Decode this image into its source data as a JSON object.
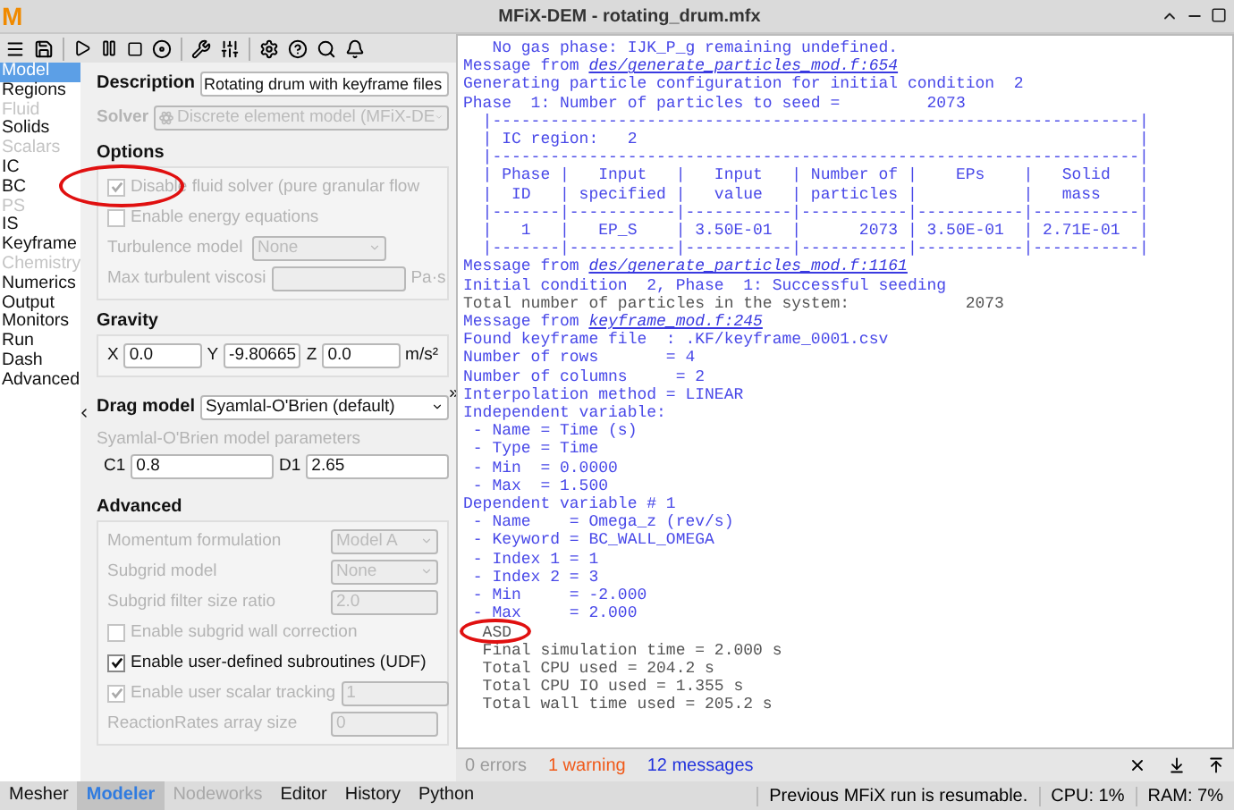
{
  "app": {
    "logo": "M",
    "title": "MFiX-DEM - rotating_drum.mfx"
  },
  "nav": [
    {
      "label": "Model",
      "selected": true,
      "disabled": false
    },
    {
      "label": "Regions",
      "selected": false,
      "disabled": false
    },
    {
      "label": "Fluid",
      "selected": false,
      "disabled": true
    },
    {
      "label": "Solids",
      "selected": false,
      "disabled": false
    },
    {
      "label": "Scalars",
      "selected": false,
      "disabled": true
    },
    {
      "label": "IC",
      "selected": false,
      "disabled": false
    },
    {
      "label": "BC",
      "selected": false,
      "disabled": false
    },
    {
      "label": "PS",
      "selected": false,
      "disabled": true
    },
    {
      "label": "IS",
      "selected": false,
      "disabled": false
    },
    {
      "label": "Keyframe",
      "selected": false,
      "disabled": false
    },
    {
      "label": "Chemistry",
      "selected": false,
      "disabled": true
    },
    {
      "label": "Numerics",
      "selected": false,
      "disabled": false
    },
    {
      "label": "Output",
      "selected": false,
      "disabled": false
    },
    {
      "label": "Monitors",
      "selected": false,
      "disabled": false
    },
    {
      "label": "Run",
      "selected": false,
      "disabled": false
    },
    {
      "label": "Dash",
      "selected": false,
      "disabled": false
    },
    {
      "label": "Advanced",
      "selected": false,
      "disabled": false
    }
  ],
  "form": {
    "description": {
      "label": "Description",
      "value": "Rotating drum with keyframe files"
    },
    "solver": {
      "label": "Solver",
      "value": "Discrete element model (MFiX-DE",
      "disabled": true
    },
    "options": {
      "heading": "Options",
      "items": [
        {
          "kind": "checkbox",
          "label": "Disable fluid solver (pure granular flow",
          "checked": true,
          "disabled": true
        },
        {
          "kind": "checkbox",
          "label": "Enable energy equations",
          "checked": false,
          "disabled": true
        },
        {
          "kind": "combo",
          "label": "Turbulence model",
          "value": "None",
          "disabled": true
        },
        {
          "kind": "input",
          "label": "Max turbulent viscosi",
          "unit": "Pa·s",
          "disabled": true
        }
      ]
    },
    "gravity": {
      "heading": "Gravity",
      "fields": [
        {
          "label": "X",
          "value": "0.0"
        },
        {
          "label": "Y",
          "value": "-9.80665"
        },
        {
          "label": "Z",
          "value": "0.0"
        }
      ],
      "unit": "m/s²"
    },
    "drag": {
      "label": "Drag model",
      "value": "Syamlal-O'Brien (default)"
    },
    "drag_params": {
      "title": "Syamlal-O'Brien model parameters",
      "fields": [
        {
          "label": "C1",
          "value": "0.8"
        },
        {
          "label": "D1",
          "value": "2.65"
        }
      ]
    },
    "advanced": {
      "heading": "Advanced",
      "items": [
        {
          "kind": "combo",
          "label": "Momentum formulation",
          "value": "Model A",
          "disabled": true
        },
        {
          "kind": "combo",
          "label": "Subgrid model",
          "value": "None",
          "disabled": true
        },
        {
          "kind": "input",
          "label": "Subgrid filter size ratio",
          "value": "2.0",
          "disabled": true
        },
        {
          "kind": "checkbox",
          "label": "Enable subgrid wall correction",
          "checked": false,
          "disabled": true
        },
        {
          "kind": "checkbox",
          "label": "Enable user-defined subroutines (UDF)",
          "checked": true,
          "disabled": false
        },
        {
          "kind": "checkbox-input",
          "label": "Enable user scalar tracking",
          "checked": true,
          "value": "1",
          "disabled": true
        },
        {
          "kind": "input",
          "label": "ReactionRates array size",
          "value": "0",
          "disabled": true
        }
      ]
    }
  },
  "console": {
    "lines": [
      {
        "kind": "info",
        "text": "   No gas phase: IJK_P_g remaining undefined."
      },
      {
        "kind": "message",
        "text": "Message from ",
        "link": "des/generate_particles_mod.f:654"
      },
      {
        "kind": "info",
        "text": "Generating particle configuration for initial condition  2"
      },
      {
        "kind": "info",
        "text": "Phase  1: Number of particles to seed =         2073"
      },
      {
        "kind": "info",
        "text": "  |-------------------------------------------------------------------|"
      },
      {
        "kind": "info",
        "text": "  | IC region:   2                                                    |"
      },
      {
        "kind": "info",
        "text": "  |-------------------------------------------------------------------|"
      },
      {
        "kind": "info",
        "text": "  | Phase |   Input   |   Input   | Number of |    EPs    |   Solid   |"
      },
      {
        "kind": "info",
        "text": "  |  ID   | specified |   value   | particles |           |   mass    |"
      },
      {
        "kind": "info",
        "text": "  |-------|-----------|-----------|-----------|-----------|-----------|"
      },
      {
        "kind": "info",
        "text": "  |   1   |   EP_S    | 3.50E-01  |      2073 | 3.50E-01  | 2.71E-01  |"
      },
      {
        "kind": "info",
        "text": "  |-------|-----------|-----------|-----------|-----------|-----------|"
      },
      {
        "kind": "message",
        "text": "Message from ",
        "link": "des/generate_particles_mod.f:1161"
      },
      {
        "kind": "info",
        "text": "Initial condition  2, Phase  1: Successful seeding"
      },
      {
        "kind": "plain",
        "text": "Total number of particles in the system:            2073"
      },
      {
        "kind": "message",
        "text": "Message from ",
        "link": "keyframe_mod.f:245"
      },
      {
        "kind": "info",
        "text": "Found keyframe file  : .KF/keyframe_0001.csv"
      },
      {
        "kind": "info",
        "text": "Number of rows       = 4"
      },
      {
        "kind": "info",
        "text": "Number of columns     = 2"
      },
      {
        "kind": "info",
        "text": "Interpolation method = LINEAR"
      },
      {
        "kind": "info",
        "text": "Independent variable:"
      },
      {
        "kind": "info",
        "text": " - Name = Time (s)"
      },
      {
        "kind": "info",
        "text": " - Type = Time"
      },
      {
        "kind": "info",
        "text": " - Min  = 0.0000"
      },
      {
        "kind": "info",
        "text": " - Max  = 1.500"
      },
      {
        "kind": "info",
        "text": "Dependent variable # 1"
      },
      {
        "kind": "info",
        "text": " - Name    = Omega_z (rev/s)"
      },
      {
        "kind": "info",
        "text": " - Keyword = BC_WALL_OMEGA"
      },
      {
        "kind": "info",
        "text": " - Index 1 = 1"
      },
      {
        "kind": "info",
        "text": " - Index 2 = 3"
      },
      {
        "kind": "info",
        "text": " - Min     = -2.000"
      },
      {
        "kind": "info",
        "text": " - Max     = 2.000"
      },
      {
        "kind": "plain",
        "text": "  ASD"
      },
      {
        "kind": "plain",
        "text": "  Final simulation time = 2.000 s"
      },
      {
        "kind": "plain",
        "text": "  Total CPU used = 204.2 s"
      },
      {
        "kind": "plain",
        "text": "  Total CPU IO used = 1.355 s"
      },
      {
        "kind": "plain",
        "text": "  Total wall time used = 205.2 s"
      }
    ]
  },
  "messages": [
    {
      "kind": "error",
      "label": "0 errors"
    },
    {
      "kind": "warning",
      "label": "1 warning"
    },
    {
      "kind": "info",
      "label": "12 messages"
    }
  ],
  "bottom_tabs": [
    {
      "label": "Mesher",
      "selected": false,
      "disabled": false
    },
    {
      "label": "Modeler",
      "selected": true,
      "disabled": false
    },
    {
      "label": "Nodeworks",
      "selected": false,
      "disabled": true
    },
    {
      "label": "Editor",
      "selected": false,
      "disabled": false
    },
    {
      "label": "History",
      "selected": false,
      "disabled": false
    },
    {
      "label": "Python",
      "selected": false,
      "disabled": false
    }
  ],
  "status": [
    "Previous MFiX run is resumable.",
    "CPU: 1%",
    "RAM: 7%"
  ]
}
